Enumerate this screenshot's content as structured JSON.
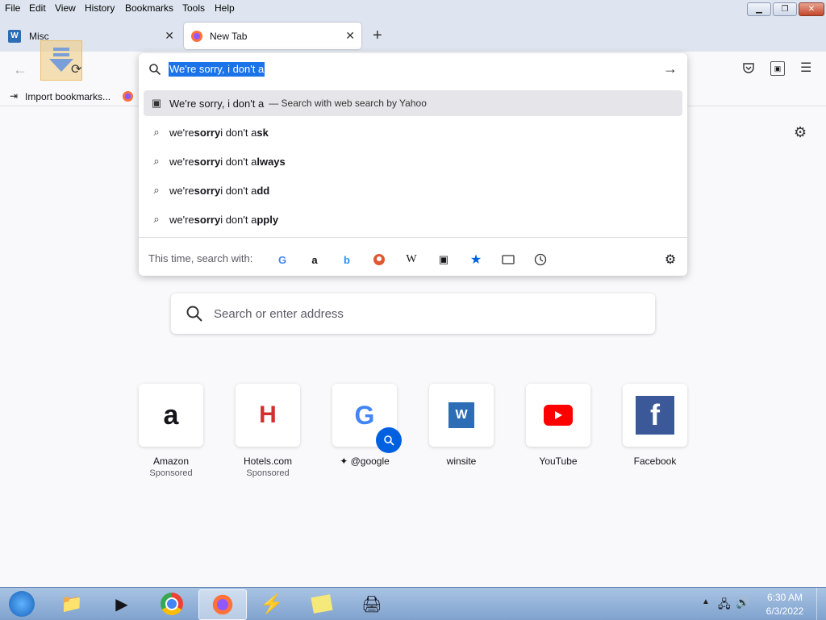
{
  "menubar": {
    "items": [
      "File",
      "Edit",
      "View",
      "History",
      "Bookmarks",
      "Tools",
      "Help"
    ]
  },
  "tabs": [
    {
      "label": "Misc"
    },
    {
      "label": "New Tab"
    }
  ],
  "bookmarks": {
    "import_label": "Import bookmarks..."
  },
  "urlbar": {
    "typed_text": "We're sorry, i don't a"
  },
  "suggestions": [
    {
      "text": "We're sorry, i don't a",
      "sub": "— Search with web search by Yahoo"
    },
    {
      "prefix": "we're ",
      "bold1": "sorry",
      "mid": " i don't a",
      "bold2": "sk"
    },
    {
      "prefix": "we're ",
      "bold1": "sorry",
      "mid": " i don't a",
      "bold2": "lways"
    },
    {
      "prefix": "we're ",
      "bold1": "sorry",
      "mid": " i don't a",
      "bold2": "dd"
    },
    {
      "prefix": "we're ",
      "bold1": "sorry",
      "mid": " i don't a",
      "bold2": "pply"
    }
  ],
  "search_with": {
    "label": "This time, search with:",
    "engines": [
      "google-icon",
      "amazon-icon",
      "bing-icon",
      "duckduckgo-icon",
      "wikipedia-icon",
      "yahoo-icon",
      "bookmarks-star-icon",
      "tabs-icon",
      "history-icon"
    ]
  },
  "newtab_search": {
    "placeholder": "Search or enter address"
  },
  "top_sites": [
    {
      "title": "Amazon",
      "sub": "Sponsored"
    },
    {
      "title": "Hotels.com",
      "sub": "Sponsored"
    },
    {
      "title": "@google",
      "sub": ""
    },
    {
      "title": "winsite",
      "sub": ""
    },
    {
      "title": "YouTube",
      "sub": ""
    },
    {
      "title": "Facebook",
      "sub": ""
    }
  ],
  "clock": {
    "time": "6:30 AM",
    "date": "6/3/2022"
  },
  "colors": {
    "accent": "#0061e0",
    "selection": "#1a73e8"
  }
}
